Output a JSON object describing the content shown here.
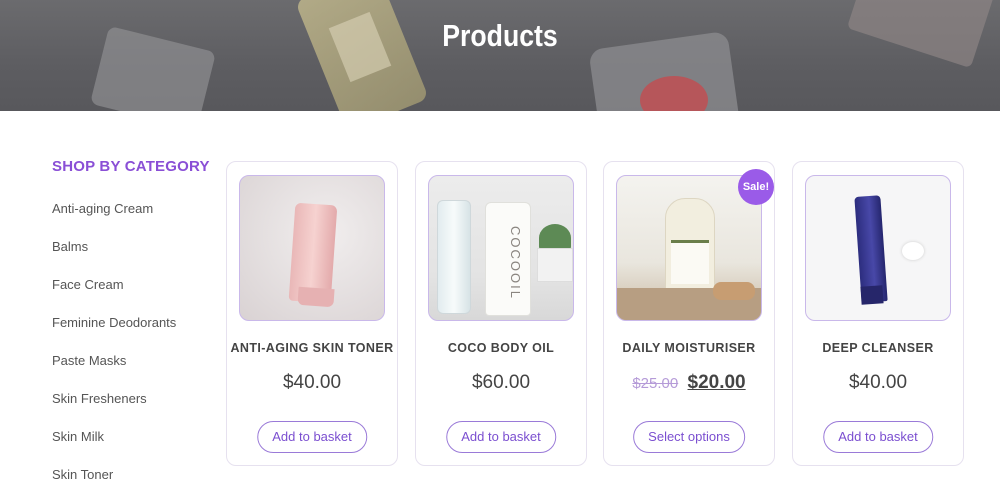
{
  "hero": {
    "title": "Products"
  },
  "sidebar": {
    "heading": "SHOP BY CATEGORY",
    "items": [
      {
        "label": "Anti-aging Cream"
      },
      {
        "label": "Balms"
      },
      {
        "label": "Face Cream"
      },
      {
        "label": "Feminine Deodorants"
      },
      {
        "label": "Paste Masks"
      },
      {
        "label": "Skin Fresheners"
      },
      {
        "label": "Skin Milk"
      },
      {
        "label": "Skin Toner"
      }
    ]
  },
  "products": [
    {
      "name": "ANTI-AGING SKIN TONER",
      "price": "$40.00",
      "button": "Add to basket"
    },
    {
      "name": "COCO BODY OIL",
      "price": "$60.00",
      "button": "Add to basket",
      "bottle_text": "COCOOIL"
    },
    {
      "name": "DAILY MOISTURISER",
      "old_price": "$25.00",
      "price": "$20.00",
      "button": "Select options",
      "badge": "Sale!"
    },
    {
      "name": "DEEP CLEANSER",
      "price": "$40.00",
      "button": "Add to basket"
    }
  ],
  "colors": {
    "accent": "#8a4fd6",
    "badge": "#9a5be8",
    "button_border": "#9a7ad8"
  }
}
